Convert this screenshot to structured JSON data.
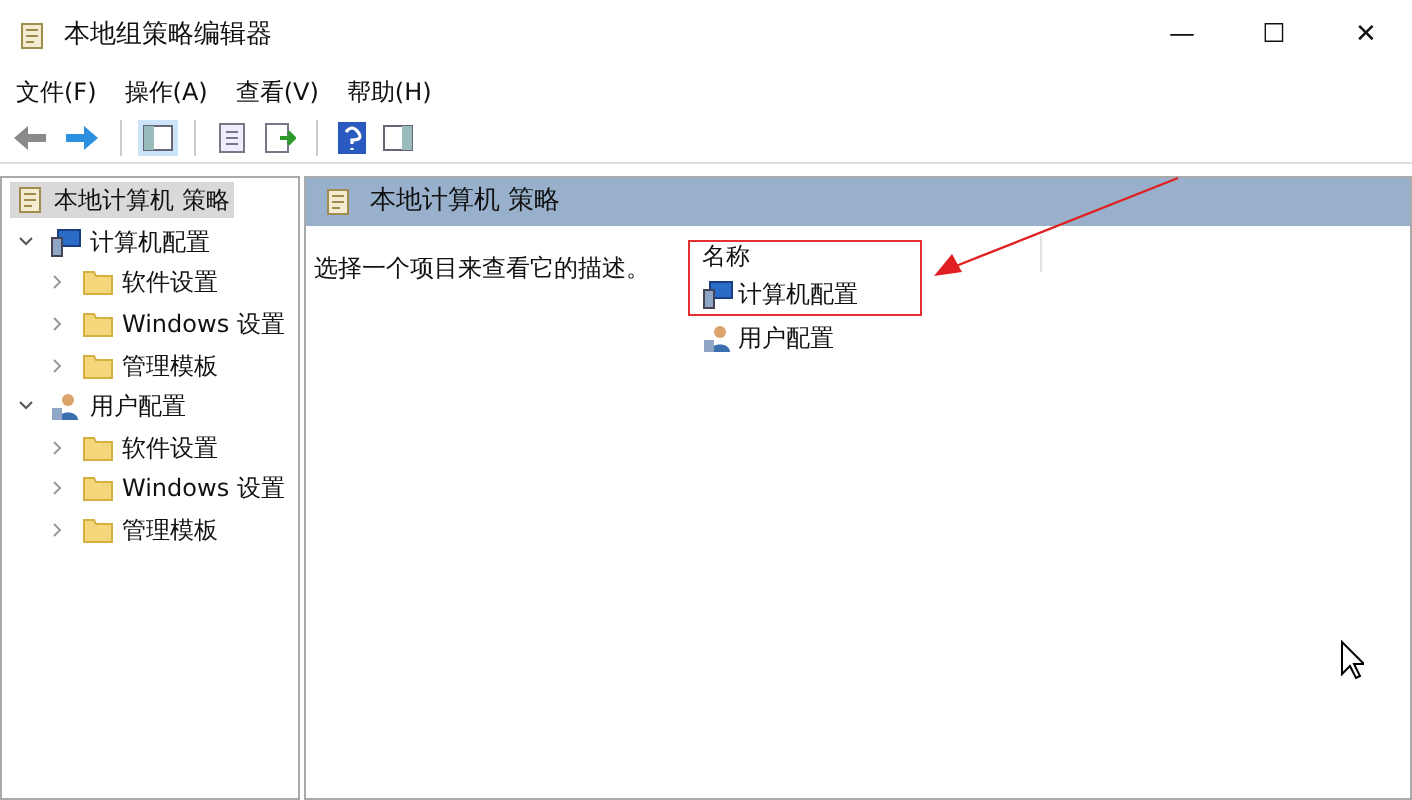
{
  "window": {
    "title": "本地组策略编辑器",
    "controls": [
      "—",
      "☐",
      "✕"
    ]
  },
  "menu": [
    "文件(F)",
    "操作(A)",
    "查看(V)",
    "帮助(H)"
  ],
  "toolbar": [
    {
      "kind": "back",
      "selected": false
    },
    {
      "kind": "forward",
      "selected": false
    },
    {
      "kind": "sep"
    },
    {
      "kind": "tree",
      "selected": true
    },
    {
      "kind": "sep"
    },
    {
      "kind": "props",
      "selected": false
    },
    {
      "kind": "export",
      "selected": false
    },
    {
      "kind": "sep"
    },
    {
      "kind": "help",
      "selected": false
    },
    {
      "kind": "panel",
      "selected": false
    }
  ],
  "tree": [
    {
      "label": "本地计算机 策略",
      "kind": "policy",
      "selected": true,
      "children": [
        {
          "label": "计算机配置",
          "kind": "computer",
          "selected": false,
          "expanded": true,
          "children": [
            {
              "label": "软件设置",
              "kind": "folder",
              "selected": false,
              "expanded": false
            },
            {
              "label": "Windows 设置",
              "kind": "folder",
              "selected": false,
              "expanded": false
            },
            {
              "label": "管理模板",
              "kind": "folder",
              "selected": false,
              "expanded": false
            }
          ]
        },
        {
          "label": "用户配置",
          "kind": "user",
          "selected": false,
          "expanded": true,
          "children": [
            {
              "label": "软件设置",
              "kind": "folder",
              "selected": false,
              "expanded": false
            },
            {
              "label": "Windows 设置",
              "kind": "folder",
              "selected": false,
              "expanded": false
            },
            {
              "label": "管理模板",
              "kind": "folder",
              "selected": false,
              "expanded": false
            }
          ]
        }
      ]
    }
  ],
  "content": {
    "header": "本地计算机 策略",
    "description": "选择一个项目来查看它的描述。",
    "column": "名称",
    "items": [
      {
        "label": "计算机配置",
        "kind": "computer"
      },
      {
        "label": "用户配置",
        "kind": "user"
      }
    ]
  }
}
